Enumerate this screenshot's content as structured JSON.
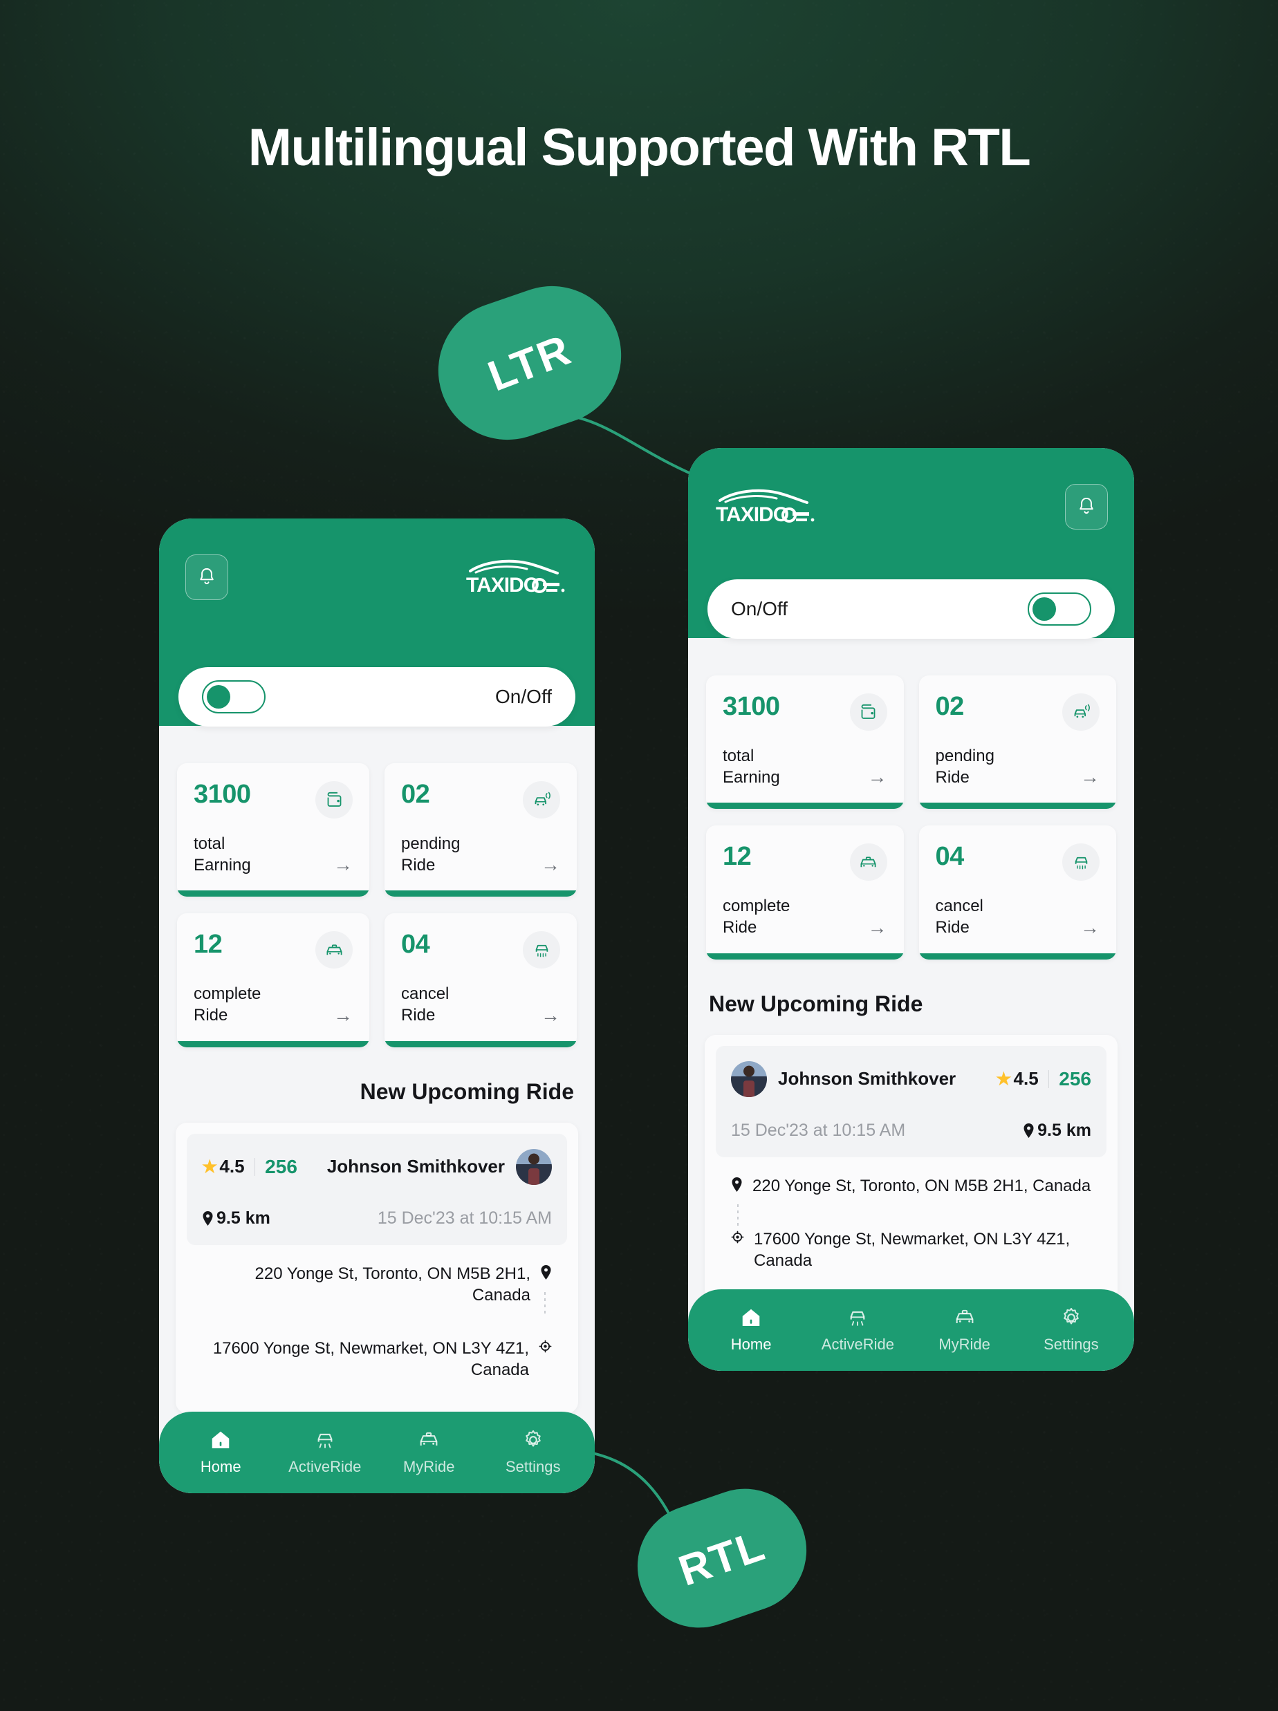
{
  "page": {
    "title": "Multilingual Supported With RTL",
    "background_color": "#141a16",
    "accent_color": "#16946B"
  },
  "badges": {
    "ltr": "LTR",
    "rtl": "RTL"
  },
  "brand": {
    "name": "TAXIDO"
  },
  "header": {
    "bell_icon": "bell-icon",
    "toggle_label": "On/Off",
    "toggle_state": "on"
  },
  "stats": [
    {
      "value": "3100",
      "label_line1": "total",
      "label_line2": "Earning",
      "icon": "wallet-icon",
      "arrow": "→"
    },
    {
      "value": "02",
      "label_line1": "pending",
      "label_line2": "Ride",
      "icon": "car-signal-icon",
      "arrow": "→"
    },
    {
      "value": "12",
      "label_line1": "complete",
      "label_line2": "Ride",
      "icon": "car-front-icon",
      "arrow": "→"
    },
    {
      "value": "04",
      "label_line1": "cancel",
      "label_line2": "Ride",
      "icon": "car-cancel-icon",
      "arrow": "→"
    }
  ],
  "upcoming": {
    "section_title": "New Upcoming Ride",
    "driver_name": "Johnson Smithkover",
    "rating": "4.5",
    "star": "★",
    "price": "256",
    "distance": "9.5 km",
    "datetime": "15 Dec'23 at 10:15 AM",
    "pickup": "220 Yonge St, Toronto, ON M5B 2H1, Canada",
    "dropoff": "17600 Yonge St, Newmarket, ON L3Y 4Z1, Canada",
    "pickup_icon": "map-pin-icon",
    "dropoff_icon": "target-pin-icon"
  },
  "nav": [
    {
      "label": "Home",
      "icon": "home-icon",
      "active": true
    },
    {
      "label": "ActiveRide",
      "icon": "active-ride-icon",
      "active": false
    },
    {
      "label": "MyRide",
      "icon": "my-ride-icon",
      "active": false
    },
    {
      "label": "Settings",
      "icon": "gear-icon",
      "active": false
    }
  ]
}
